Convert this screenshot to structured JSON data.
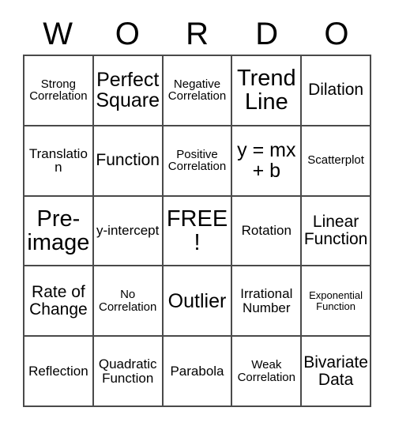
{
  "card": {
    "title_letters": [
      "W",
      "O",
      "R",
      "D",
      "O"
    ],
    "rows": [
      [
        {
          "label": "Strong Correlation"
        },
        {
          "label": "Perfect Square"
        },
        {
          "label": "Negative Correlation"
        },
        {
          "label": "Trend Line"
        },
        {
          "label": "Dilation"
        }
      ],
      [
        {
          "label": "Translation"
        },
        {
          "label": "Function"
        },
        {
          "label": "Positive Correlation"
        },
        {
          "label": "y = mx + b"
        },
        {
          "label": "Scatterplot"
        }
      ],
      [
        {
          "label": "Pre-image"
        },
        {
          "label": "y-intercept"
        },
        {
          "label": "FREE!"
        },
        {
          "label": "Rotation"
        },
        {
          "label": "Linear Function"
        }
      ],
      [
        {
          "label": "Rate of Change"
        },
        {
          "label": "No Correlation"
        },
        {
          "label": "Outlier"
        },
        {
          "label": "Irrational Number"
        },
        {
          "label": "Exponential Function"
        }
      ],
      [
        {
          "label": "Reflection"
        },
        {
          "label": "Quadratic Function"
        },
        {
          "label": "Parabola"
        },
        {
          "label": "Weak Correlation"
        },
        {
          "label": "Bivariate Data"
        }
      ]
    ],
    "colors": {
      "background": "#ffffff",
      "text": "#000000",
      "grid_line": "#4a4a4a"
    }
  }
}
